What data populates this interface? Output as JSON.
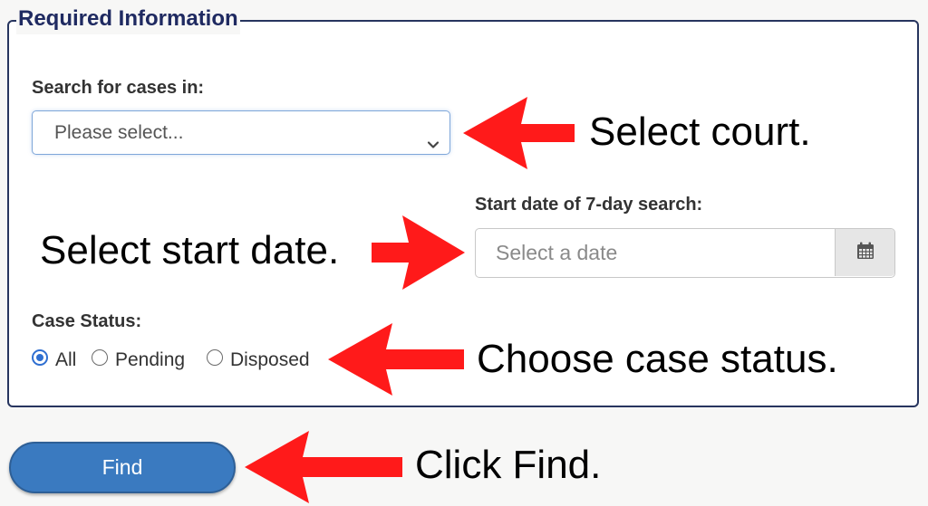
{
  "form": {
    "legend": "Required Information",
    "court_select": {
      "label": "Search for cases in:",
      "selected_value": "Please select..."
    },
    "start_date": {
      "label": "Start date of 7-day search:",
      "placeholder": "Select a date"
    },
    "case_status": {
      "label": "Case Status:",
      "options": [
        {
          "label": "All",
          "checked": true
        },
        {
          "label": "Pending",
          "checked": false
        },
        {
          "label": "Disposed",
          "checked": false
        }
      ]
    },
    "find_label": "Find"
  },
  "annotations": {
    "select_court": "Select court.",
    "select_start_date": "Select start date.",
    "choose_case_status": "Choose case status.",
    "click_find": "Click Find."
  },
  "colors": {
    "legend_text": "#1f2a61",
    "fieldset_border": "#27355f",
    "find_button": "#3a7ac0",
    "arrow": "#ff1a1a",
    "radio_selected": "#2f6fd1"
  },
  "icons": {
    "calendar": "calendar-icon",
    "chevron": "chevron-down-icon",
    "arrow": "arrow-left-icon"
  }
}
